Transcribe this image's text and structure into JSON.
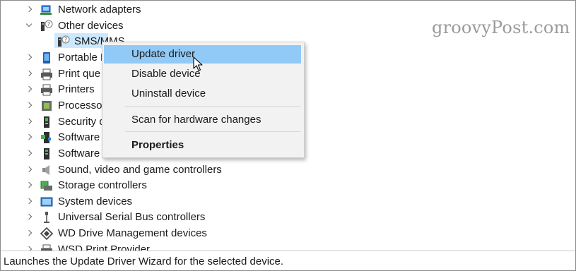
{
  "tree": {
    "rows": [
      {
        "label": "Network adapters",
        "icon": "network-adapter-icon",
        "expander": "right"
      },
      {
        "label": "Other devices",
        "icon": "unknown-device-icon",
        "expander": "down"
      },
      {
        "label": "SMS/MMS",
        "icon": "unknown-device-icon",
        "expander": "none",
        "selected": true
      },
      {
        "label": "Portable D",
        "icon": "portable-device-icon",
        "expander": "right"
      },
      {
        "label": "Print que",
        "icon": "printer-icon",
        "expander": "right"
      },
      {
        "label": "Printers",
        "icon": "printer-icon",
        "expander": "right"
      },
      {
        "label": "Processor",
        "icon": "processor-icon",
        "expander": "right"
      },
      {
        "label": "Security d",
        "icon": "security-device-icon",
        "expander": "right"
      },
      {
        "label": "Software",
        "icon": "software-component-icon",
        "expander": "right"
      },
      {
        "label": "Software",
        "icon": "software-device-icon",
        "expander": "right"
      },
      {
        "label": "Sound, video and game controllers",
        "icon": "speaker-icon",
        "expander": "right"
      },
      {
        "label": "Storage controllers",
        "icon": "storage-controller-icon",
        "expander": "right"
      },
      {
        "label": "System devices",
        "icon": "system-device-icon",
        "expander": "right"
      },
      {
        "label": "Universal Serial Bus controllers",
        "icon": "usb-icon",
        "expander": "right"
      },
      {
        "label": "WD Drive Management devices",
        "icon": "wd-drive-icon",
        "expander": "right"
      },
      {
        "label": "WSD Print Provider",
        "icon": "printer-icon",
        "expander": "right"
      }
    ]
  },
  "context_menu": {
    "items": [
      {
        "label": "Update driver",
        "highlighted": true
      },
      {
        "label": "Disable device"
      },
      {
        "label": "Uninstall device"
      },
      {
        "label": "Scan for hardware changes"
      },
      {
        "label": "Properties",
        "bold": true
      }
    ]
  },
  "watermark": "groovyPost.com",
  "status_bar": {
    "text": "Launches the Update Driver Wizard for the selected device."
  },
  "colors": {
    "selection": "#cce8ff",
    "menu_highlight": "#91c9f7",
    "menu_background": "#f2f2f2"
  }
}
